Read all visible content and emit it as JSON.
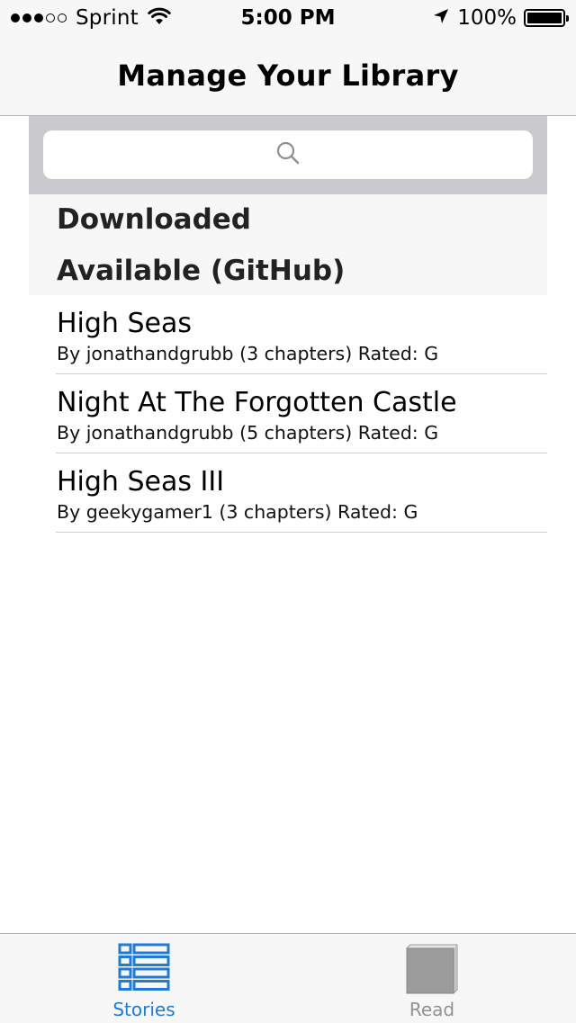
{
  "status_bar": {
    "carrier": "Sprint",
    "time": "5:00 PM",
    "battery": "100%",
    "signal_bars_filled": 3,
    "signal_bars_total": 5
  },
  "nav": {
    "title": "Manage Your Library"
  },
  "search": {
    "placeholder": "",
    "value": "",
    "icon": "search-icon"
  },
  "sections": {
    "downloaded": "Downloaded",
    "available": "Available (GitHub)"
  },
  "stories": [
    {
      "title": "High Seas",
      "subtitle": "By jonathandgrubb (3 chapters) Rated: G"
    },
    {
      "title": "Night At The Forgotten Castle",
      "subtitle": "By jonathandgrubb (5 chapters) Rated: G"
    },
    {
      "title": "High Seas III",
      "subtitle": "By geekygamer1 (3 chapters) Rated: G"
    }
  ],
  "tabs": [
    {
      "label": "Stories",
      "icon": "list-icon",
      "selected": true
    },
    {
      "label": "Read",
      "icon": "book-icon",
      "selected": false
    }
  ],
  "colors": {
    "accent": "#1f7bd8",
    "inactive": "#929292",
    "bar_background": "#f7f7f7",
    "search_background": "#c9c9ce"
  }
}
